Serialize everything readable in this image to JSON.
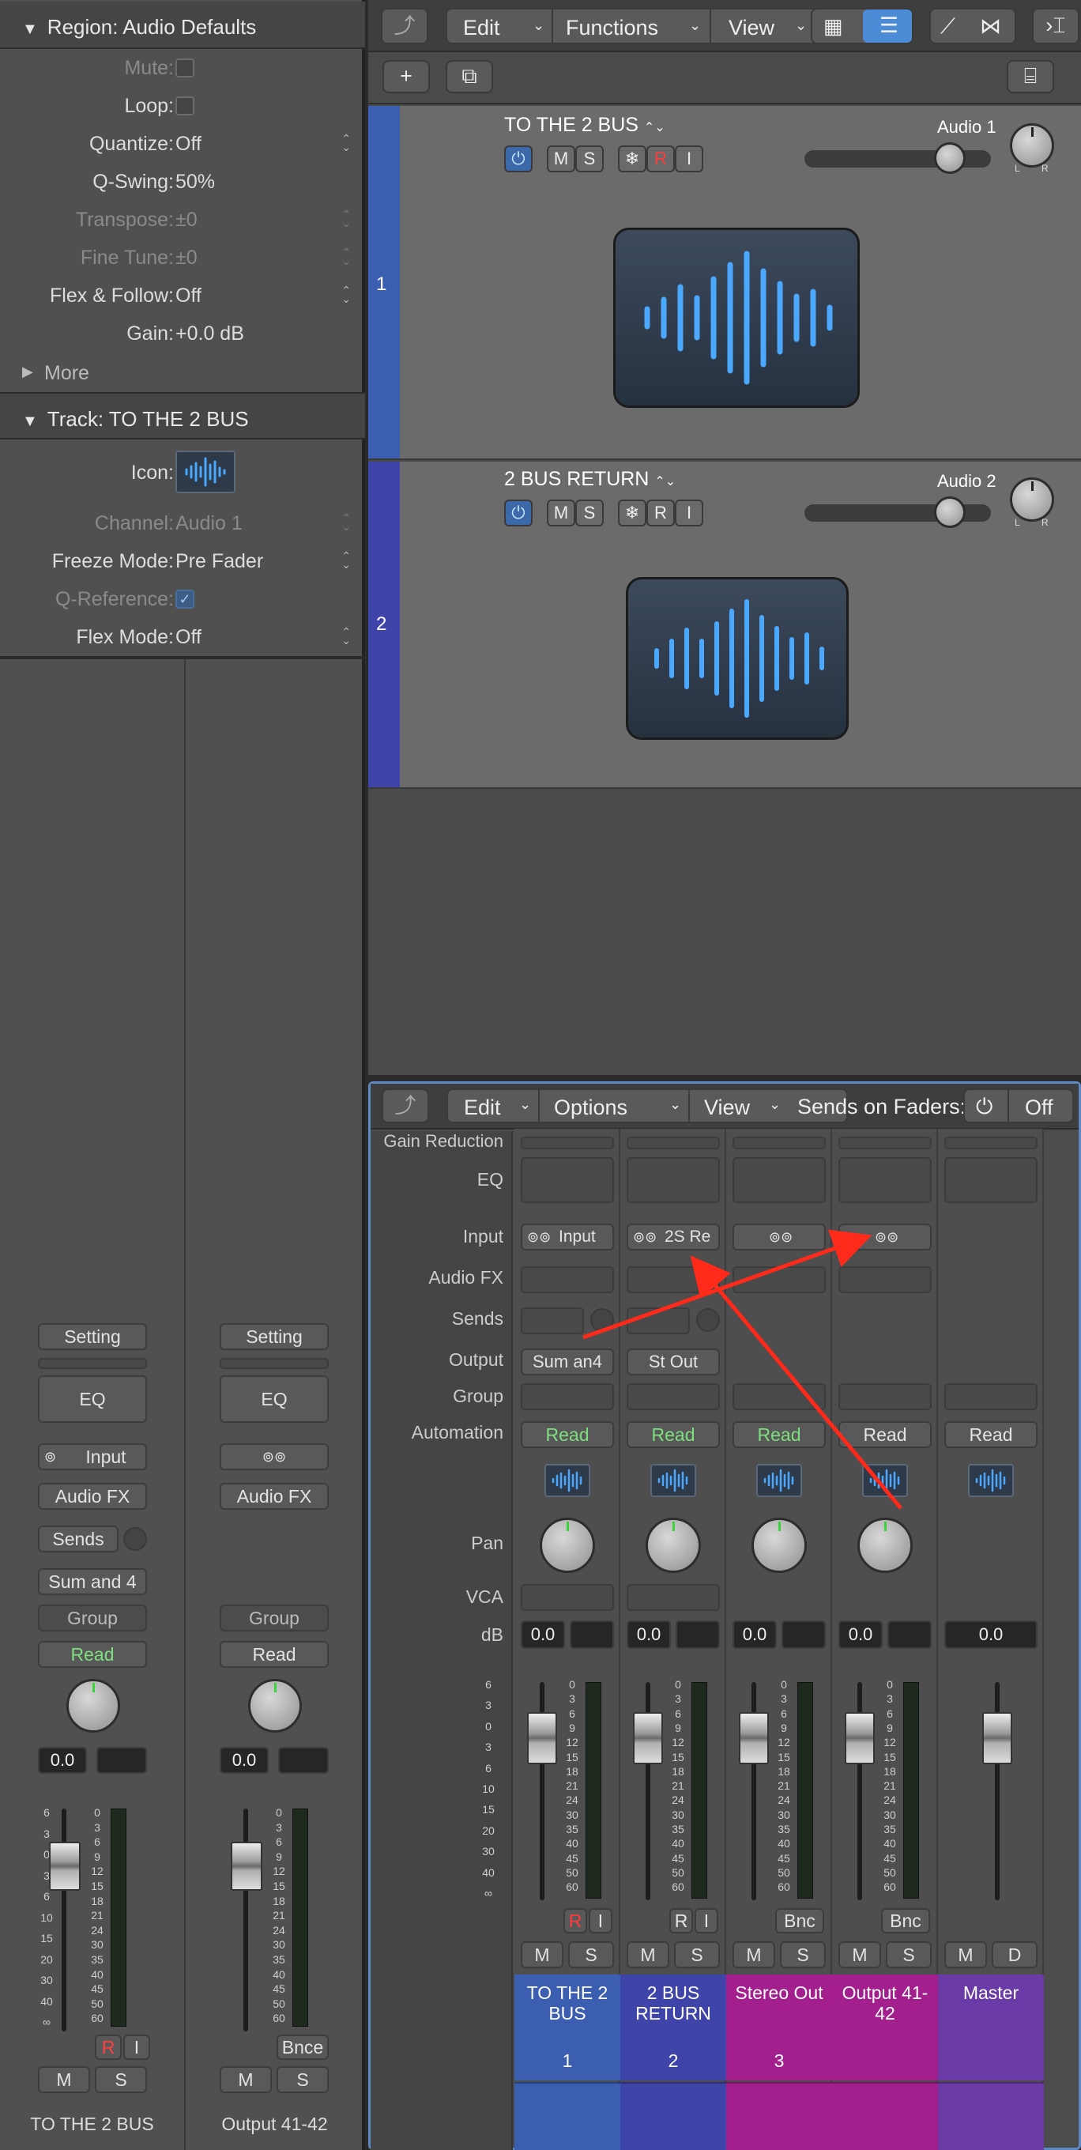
{
  "inspector": {
    "region_header": {
      "title": "Region: Audio Defaults"
    },
    "region_rows": {
      "mute": {
        "label": "Mute:"
      },
      "loop": {
        "label": "Loop:"
      },
      "quantize": {
        "label": "Quantize:",
        "value": "Off"
      },
      "qswing": {
        "label": "Q-Swing:",
        "value": "50%"
      },
      "transpose": {
        "label": "Transpose:",
        "value": "±0"
      },
      "finetune": {
        "label": "Fine Tune:",
        "value": "±0"
      },
      "flex": {
        "label": "Flex & Follow:",
        "value": "Off"
      },
      "gain": {
        "label": "Gain:",
        "value": "+0.0 dB"
      }
    },
    "more": "More",
    "track_header": {
      "title": "Track:  TO THE 2 BUS"
    },
    "track_rows": {
      "icon": {
        "label": "Icon:"
      },
      "channel": {
        "label": "Channel:",
        "value": "Audio 1"
      },
      "freeze": {
        "label": "Freeze Mode:",
        "value": "Pre Fader"
      },
      "qref": {
        "label": "Q-Reference:",
        "value": "✓"
      },
      "flexmode": {
        "label": "Flex Mode:",
        "value": "Off"
      }
    },
    "strip1": {
      "setting": "Setting",
      "eq": "EQ",
      "input": "Input",
      "audiofx": "Audio FX",
      "sends": "Sends",
      "output": "Sum  and 4",
      "group": "Group",
      "automation": "Read",
      "db": "0.0",
      "r": "R",
      "i": "I",
      "m": "M",
      "s": "S",
      "name": "TO THE 2 BUS"
    },
    "strip2": {
      "setting": "Setting",
      "eq": "EQ",
      "audiofx": "Audio FX",
      "group": "Group",
      "automation": "Read",
      "db": "0.0",
      "bnce": "Bnce",
      "m": "M",
      "s": "S",
      "name": "Output 41-42"
    },
    "scale": [
      "0",
      "3",
      "6",
      "9",
      "12",
      "15",
      "18",
      "21",
      "24",
      "30",
      "35",
      "40",
      "45",
      "50",
      "60"
    ]
  },
  "tracks_toolbar": {
    "edit": "Edit",
    "functions": "Functions",
    "view": "View"
  },
  "tracks": [
    {
      "num": "1",
      "name": "TO THE 2 BUS",
      "channel": "Audio 1",
      "m": "M",
      "s": "S",
      "r": "R",
      "i": "I"
    },
    {
      "num": "2",
      "name": "2 BUS RETURN",
      "channel": "Audio 2",
      "m": "M",
      "s": "S",
      "r": "R",
      "i": "I"
    }
  ],
  "mixer": {
    "toolbar": {
      "edit": "Edit",
      "options": "Options",
      "view": "View",
      "sends_on_faders": "Sends on Faders:",
      "off": "Off"
    },
    "labels": {
      "gain_reduction": "Gain Reduction",
      "eq": "EQ",
      "input": "Input",
      "audio_fx": "Audio FX",
      "sends": "Sends",
      "output": "Output",
      "group": "Group",
      "automation": "Automation",
      "pan": "Pan",
      "vca": "VCA",
      "db": "dB"
    },
    "strips": [
      {
        "input": "Input",
        "output": "Sum  an4",
        "automation": "Read",
        "db": "0.0",
        "r": "R",
        "i": "I",
        "m": "M",
        "s": "S",
        "name": "TO THE 2 BUS",
        "num": "1"
      },
      {
        "input": "2S Re",
        "output": "St Out",
        "automation": "Read",
        "db": "0.0",
        "r": "R",
        "i": "I",
        "m": "M",
        "s": "S",
        "name": "2 BUS RETURN",
        "num": "2"
      },
      {
        "automation": "Read",
        "db": "0.0",
        "bnc": "Bnc",
        "m": "M",
        "s": "S",
        "name": "Stereo Out",
        "num": "3"
      },
      {
        "automation": "Read",
        "db": "0.0",
        "bnc": "Bnc",
        "m": "M",
        "s": "S",
        "name": "Output 41-42"
      },
      {
        "automation": "Read",
        "db": "0.0",
        "m": "M",
        "d": "D",
        "name": "Master"
      }
    ],
    "scale_left": [
      "6",
      "3",
      "0",
      "3",
      "6",
      "10",
      "15",
      "20",
      "30",
      "40",
      "∞"
    ],
    "scale_right": [
      "0",
      "3",
      "6",
      "9",
      "12",
      "15",
      "18",
      "21",
      "24",
      "30",
      "35",
      "40",
      "45",
      "50",
      "60"
    ]
  },
  "colors": {
    "track1": "#3c5eb0",
    "track2": "#3f44a8",
    "stereo": "#a41f8e",
    "output": "#a41f8e",
    "master": "#6a3aa6",
    "automation_green": "#7ddf7d",
    "accent": "#4c8bd6"
  }
}
